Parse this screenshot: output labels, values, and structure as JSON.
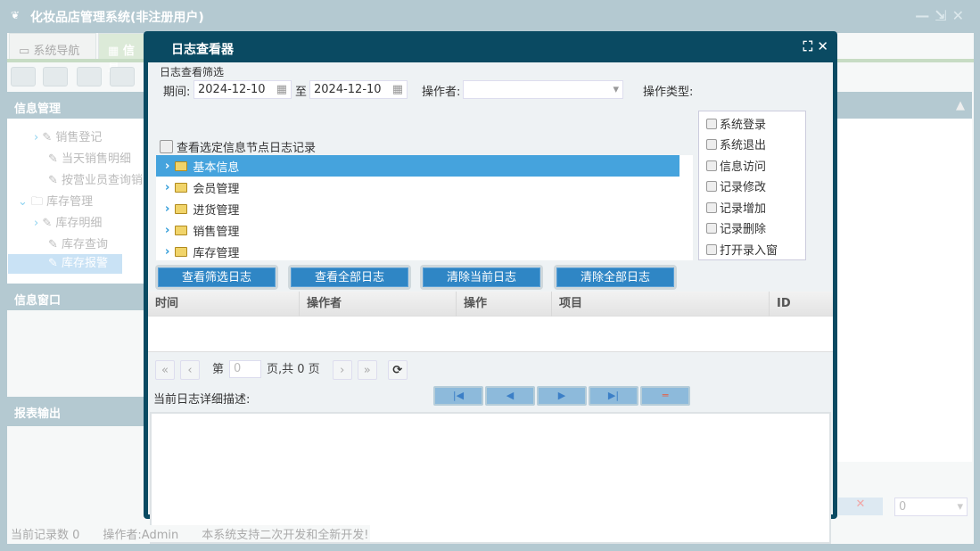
{
  "window": {
    "title": "化妆品店管理系统(非注册用户)",
    "controls": [
      "—",
      "⇲",
      "✕"
    ]
  },
  "tabs": [
    {
      "label": "系统导航"
    },
    {
      "label": "信息"
    }
  ],
  "left": {
    "panel1": "信息管理",
    "panel2": "信息窗口",
    "panel3": "报表输出",
    "tree": [
      {
        "label": "销售登记"
      },
      {
        "label": "当天销售明细"
      },
      {
        "label": "按营业员查询销"
      },
      {
        "label": "库存管理"
      },
      {
        "label": "库存明细"
      },
      {
        "label": "库存查询"
      },
      {
        "label": "库存报警"
      }
    ]
  },
  "status": {
    "records": "当前记录数 0",
    "operator": "操作者:Admin",
    "note": "本系统支持二次开发和全新开发!"
  },
  "right": {
    "select_value": "0"
  },
  "dialog": {
    "title": "日志查看器",
    "filter_label": "日志查看筛选",
    "period_label": "期间:",
    "date_from": "2024-12-10",
    "to_label": "至",
    "date_to": "2024-12-10",
    "operator_label": "操作者:",
    "operator_value": "",
    "optype_label": "操作类型:",
    "op_types": [
      "系统登录",
      "系统退出",
      "信息访问",
      "记录修改",
      "记录增加",
      "记录删除",
      "打开录入窗"
    ],
    "node_check_label": "查看选定信息节点日志记录",
    "tree": [
      "基本信息",
      "会员管理",
      "进货管理",
      "销售管理",
      "库存管理"
    ],
    "buttons": [
      "查看筛选日志",
      "查看全部日志",
      "清除当前日志",
      "清除全部日志"
    ],
    "columns": [
      "时间",
      "操作者",
      "操作",
      "项目",
      "ID"
    ],
    "pager": {
      "page_prefix": "第",
      "page_value": "0",
      "page_suffix": "页,共 0 页"
    },
    "detail_label": "当前日志详细描述:",
    "nav": [
      "|◀",
      "◀",
      "▶",
      "▶|",
      "═"
    ]
  }
}
